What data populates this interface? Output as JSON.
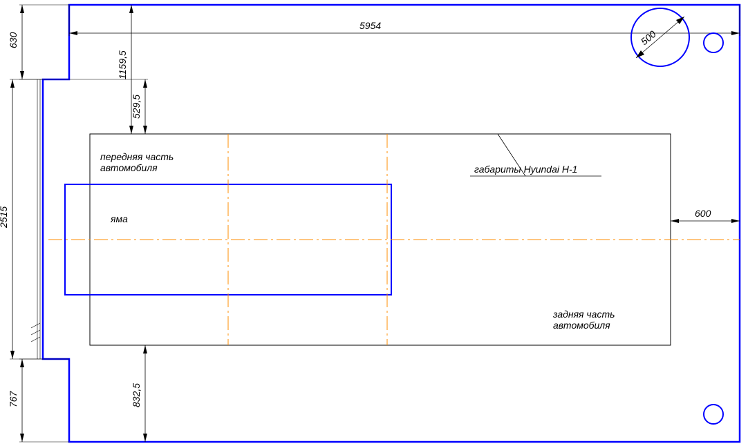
{
  "dims": {
    "top_width": "5954",
    "left_upper": "630",
    "left_lower": "2515",
    "bottom_left": "767",
    "right_gap": "600",
    "inner_top": "1159,5",
    "inner_529": "529,5",
    "inner_832": "832,5",
    "circle_diam": "500"
  },
  "labels": {
    "front": "передняя часть\nавтомобиля",
    "pit": "яма",
    "vehicle": "габариты Hyundai H-1",
    "rear": "задняя часть\nавтомобиля"
  },
  "colors": {
    "outline_blue": "#0000ff",
    "thin_black": "#000000",
    "centerline": "#ff8c00"
  }
}
